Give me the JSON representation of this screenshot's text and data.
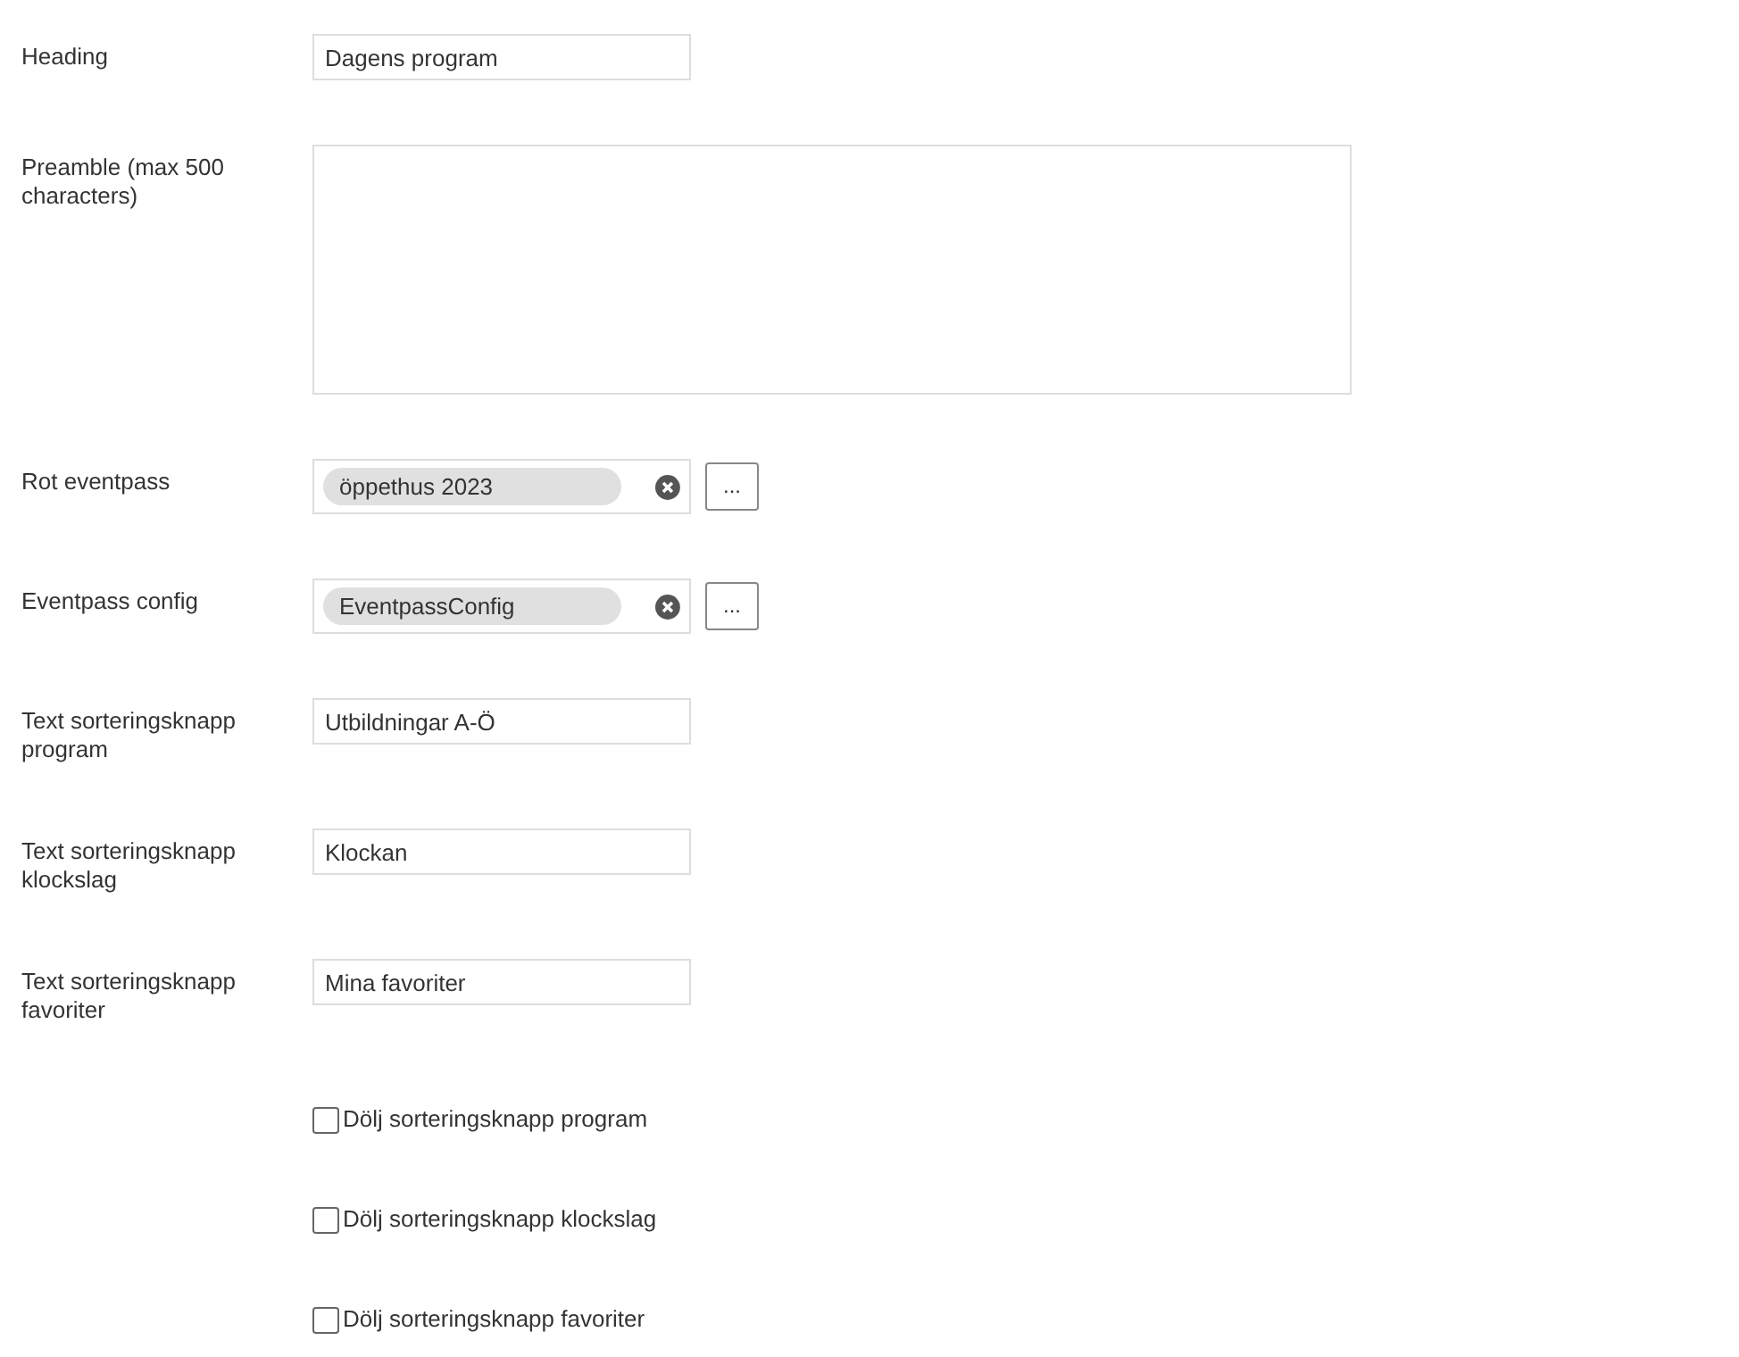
{
  "fields": [
    {
      "kind": "text",
      "label": "Heading",
      "value": "Dagens program"
    },
    {
      "kind": "textarea",
      "label": "Preamble (max 500 characters)"
    },
    {
      "kind": "picker",
      "label": "Rot eventpass",
      "value": "öppethus 2023",
      "button": "..."
    },
    {
      "kind": "picker",
      "label": "Eventpass config",
      "value": "EventpassConfig",
      "button": "..."
    },
    {
      "kind": "text",
      "label": "Text sorteringsknapp program",
      "value": "Utbildningar A-Ö"
    },
    {
      "kind": "text",
      "label": "Text sorteringsknapp klockslag",
      "value": "Klockan"
    },
    {
      "kind": "text",
      "label": "Text sorteringsknapp favoriter",
      "value": "Mina favoriter"
    },
    {
      "kind": "checkbox",
      "label": "Dölj sorteringsknapp program",
      "checked": false
    },
    {
      "kind": "checkbox",
      "label": "Dölj sorteringsknapp klockslag",
      "checked": false
    },
    {
      "kind": "checkbox",
      "label": "Dölj sorteringsknapp favoriter",
      "checked": false
    }
  ]
}
